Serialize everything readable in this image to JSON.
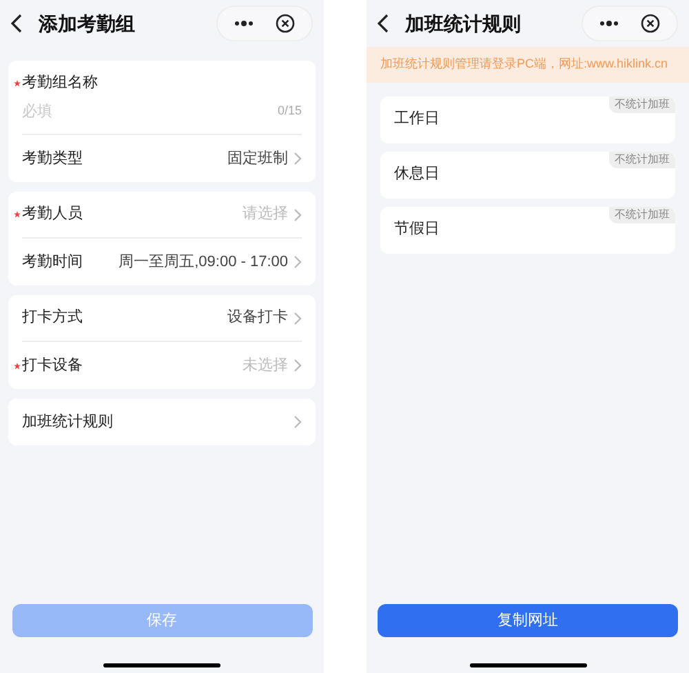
{
  "left": {
    "title": "添加考勤组",
    "sections": [
      {
        "rows": [
          {
            "kind": "input",
            "label": "考勤组名称",
            "required": true,
            "placeholder": "必填",
            "counter": "0/15"
          },
          {
            "kind": "select",
            "label": "考勤类型",
            "required": false,
            "value": "固定班制"
          }
        ]
      },
      {
        "rows": [
          {
            "kind": "select",
            "label": "考勤人员",
            "required": true,
            "placeholder": "请选择"
          },
          {
            "kind": "select",
            "label": "考勤时间",
            "required": false,
            "value": "周一至周五,09:00 - 17:00"
          }
        ]
      },
      {
        "rows": [
          {
            "kind": "select",
            "label": "打卡方式",
            "required": false,
            "value": "设备打卡"
          },
          {
            "kind": "select",
            "label": "打卡设备",
            "required": true,
            "placeholder": "未选择"
          }
        ]
      },
      {
        "rows": [
          {
            "kind": "select",
            "label": "加班统计规则",
            "required": false
          }
        ]
      }
    ],
    "button": {
      "label": "保存",
      "disabled": true
    }
  },
  "right": {
    "title": "加班统计规则",
    "notice": "加班统计规则管理请登录PC端，网址:www.hiklink.cn",
    "rules": [
      {
        "label": "工作日",
        "tag": "不统计加班"
      },
      {
        "label": "休息日",
        "tag": "不统计加班"
      },
      {
        "label": "节假日",
        "tag": "不统计加班"
      }
    ],
    "button": {
      "label": "复制网址",
      "disabled": false
    }
  }
}
